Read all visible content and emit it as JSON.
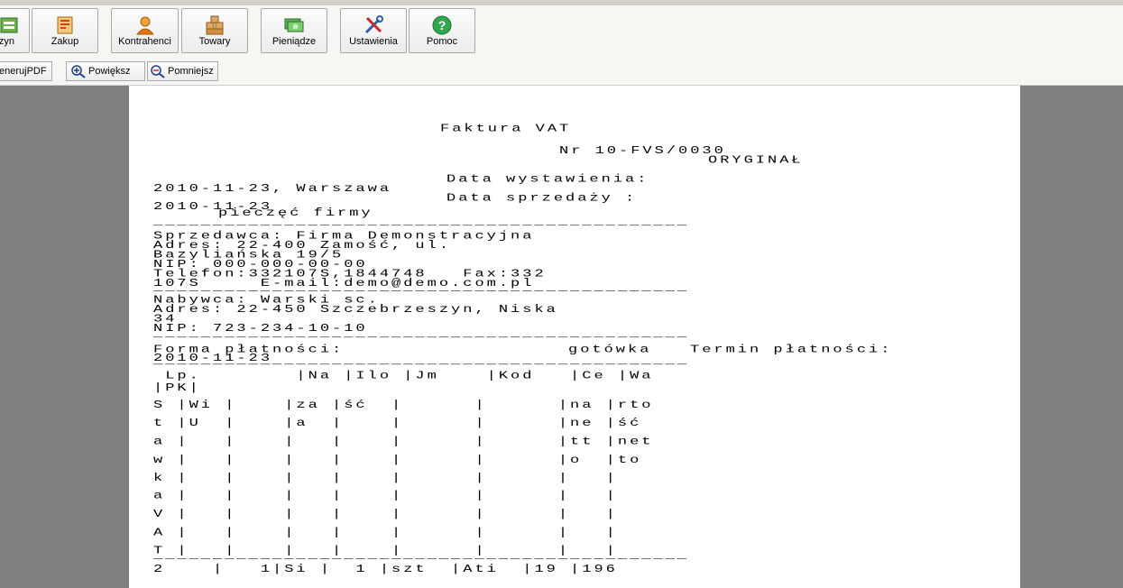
{
  "toolbar": {
    "buttons": [
      {
        "label": "zyn",
        "icon": "warehouse-icon"
      },
      {
        "label": "Zakup",
        "icon": "purchase-icon"
      },
      {
        "label": "Kontrahenci",
        "icon": "contractor-icon"
      },
      {
        "label": "Towary",
        "icon": "goods-boxes-icon"
      },
      {
        "label": "Pieniądze",
        "icon": "money-icon"
      },
      {
        "label": "Ustawienia",
        "icon": "settings-tools-icon"
      },
      {
        "label": "Pomoc",
        "icon": "help-icon"
      }
    ],
    "secondary": [
      {
        "label": "enerujPDF"
      },
      {
        "label": "Powiększ",
        "icon": "zoom-in-icon"
      },
      {
        "label": "Pomniejsz",
        "icon": "zoom-out-icon"
      }
    ]
  },
  "document": {
    "title": "Faktura VAT",
    "number": "Nr 10-FVS/0030",
    "copy_type": "ORYGINAŁ",
    "issue_date_label": "Data wystawienia:",
    "issue_place_date": "2010-11-23, Warszawa",
    "sale_date_label": "Data sprzedaży :",
    "sale_date": "2010-11-23",
    "stamp_label": "pieczęć firmy",
    "separator": "_____________________________________________",
    "seller": [
      "Sprzedawca: Firma Demonstracyjna",
      "Adres: 22-400 Zamość, ul.",
      "Bazyliańska 19/5",
      "NIP: 000-000-00-00",
      "Telefon:332107S,1844748   Fax:332",
      "107S     E-mail:demo@demo.com.pl"
    ],
    "buyer": [
      "Nabywca: Warski sc.",
      "Adres: 22-450 Szczebrzeszyn, Niska",
      "34",
      "NIP: 723-234-10-10"
    ],
    "payment_form_label": "Forma płatności:",
    "payment_form_value": "gotówka",
    "payment_date_label": "Termin płatności:",
    "payment_date": "2010-11-23",
    "table_header_row1": " Lp.        |Na |Ilo |Jm    |Kod   |Ce |Wa ",
    "table_header_row2": "|PK|       ",
    "table_body": [
      "S |Wi |    |za |ść  |      |      |na |rto ",
      "t |U  |    |a  |    |      |      |ne |ść  ",
      "a |   |    |   |    |      |      |tt |net ",
      "w |   |    |   |    |      |      |o  |to  ",
      "k |   |    |   |    |      |      |   |    ",
      "a |   |    |   |    |      |      |   |    ",
      "V |   |    |   |    |      |      |   |    ",
      "A |   |    |   |    |      |      |   |    ",
      "T |   |    |   |    |      |      |   |    "
    ],
    "first_item": "2    |   1|Si |  1 |szt  |Ati  |19 |196"
  }
}
